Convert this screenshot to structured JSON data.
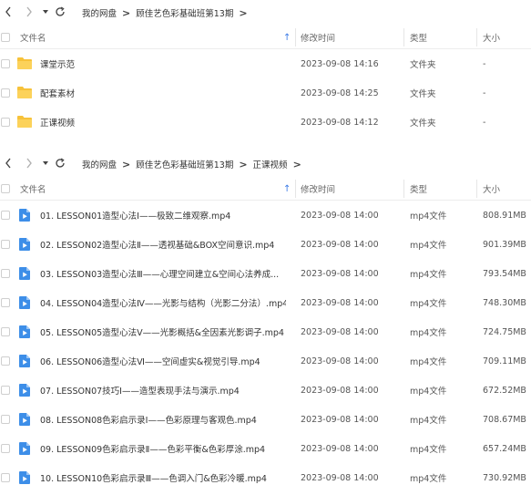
{
  "pane1": {
    "nav": {
      "back_icon": "chevron-left-icon",
      "forward_icon": "chevron-right-icon",
      "history_icon": "caret-down-icon",
      "refresh_icon": "refresh-icon",
      "breadcrumbs": [
        "我的网盘",
        "顾佳艺色彩基础班第13期"
      ],
      "separator": ">"
    },
    "header": {
      "name": "文件名",
      "time": "修改时间",
      "type": "类型",
      "size": "大小"
    },
    "rows": [
      {
        "name": "课堂示范",
        "time": "2023-09-08 14:16",
        "type": "文件夹",
        "size": "-"
      },
      {
        "name": "配套素材",
        "time": "2023-09-08 14:25",
        "type": "文件夹",
        "size": "-"
      },
      {
        "name": "正课视频",
        "time": "2023-09-08 14:12",
        "type": "文件夹",
        "size": "-"
      }
    ]
  },
  "pane2": {
    "nav": {
      "breadcrumbs": [
        "我的网盘",
        "顾佳艺色彩基础班第13期",
        "正课视频"
      ],
      "separator": ">"
    },
    "header": {
      "name": "文件名",
      "time": "修改时间",
      "type": "类型",
      "size": "大小"
    },
    "rows": [
      {
        "name": "01. LESSON01造型心法Ⅰ——极致二维观察.mp4",
        "time": "2023-09-08 14:00",
        "type": "mp4文件",
        "size": "808.91MB"
      },
      {
        "name": "02. LESSON02造型心法Ⅱ——透视基础&BOX空间意识.mp4",
        "time": "2023-09-08 14:00",
        "type": "mp4文件",
        "size": "901.39MB"
      },
      {
        "name": "03. LESSON03造型心法Ⅲ——心理空间建立&空间心法养成...",
        "time": "2023-09-08 14:00",
        "type": "mp4文件",
        "size": "793.54MB"
      },
      {
        "name": "04. LESSON04造型心法Ⅳ——光影与结构（光影二分法）.mp4",
        "time": "2023-09-08 14:00",
        "type": "mp4文件",
        "size": "748.30MB"
      },
      {
        "name": "05. LESSON05造型心法Ⅴ——光影概括&全因素光影调子.mp4",
        "time": "2023-09-08 14:00",
        "type": "mp4文件",
        "size": "724.75MB"
      },
      {
        "name": "06. LESSON06造型心法Ⅵ——空间虚实&视觉引导.mp4",
        "time": "2023-09-08 14:00",
        "type": "mp4文件",
        "size": "709.11MB"
      },
      {
        "name": "07. LESSON07技巧Ⅰ——造型表现手法与演示.mp4",
        "time": "2023-09-08 14:00",
        "type": "mp4文件",
        "size": "672.52MB"
      },
      {
        "name": "08. LESSON08色彩启示录Ⅰ——色彩原理与客观色.mp4",
        "time": "2023-09-08 14:00",
        "type": "mp4文件",
        "size": "708.67MB"
      },
      {
        "name": "09. LESSON09色彩启示录Ⅱ——色彩平衡&色彩厚涂.mp4",
        "time": "2023-09-08 14:00",
        "type": "mp4文件",
        "size": "657.24MB"
      },
      {
        "name": "10. LESSON10色彩启示录Ⅲ——色调入门&色彩冷暖.mp4",
        "time": "2023-09-08 14:00",
        "type": "mp4文件",
        "size": "730.92MB"
      }
    ]
  },
  "colors": {
    "folder": "#f7c23a",
    "video": "#3d8ee8",
    "sort": "#3a7ae6"
  }
}
